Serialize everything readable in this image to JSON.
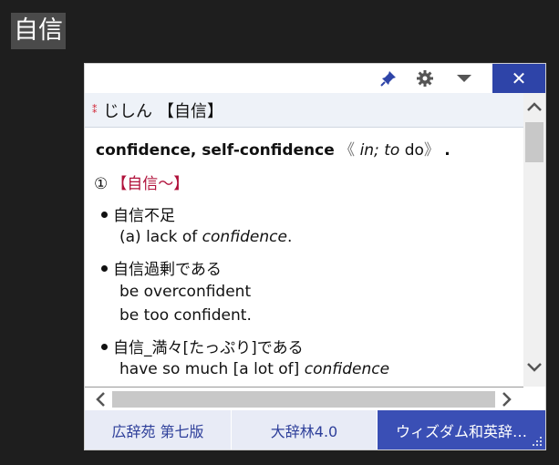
{
  "selection": {
    "text": "自信"
  },
  "toolbar": {
    "pin_icon": "pin-icon",
    "settings_icon": "gear-icon",
    "menu_icon": "dropdown-icon",
    "close_label": "✕"
  },
  "entry": {
    "asterisks": "⁑",
    "reading": "じしん",
    "headword": "【自信】",
    "translation": "confidence, self-confidence",
    "grammar_open": "《",
    "grammar_in": "in;",
    "grammar_to": "to",
    "grammar_do": "do",
    "grammar_close": "》",
    "grammar_end": ".",
    "sense_number": "①",
    "sense_label": "【自信～】",
    "examples": [
      {
        "jp": "自信不足",
        "en": [
          "(a) lack of confidence."
        ]
      },
      {
        "jp": "自信過剰である",
        "en": [
          "be overconfident",
          "be too confident."
        ]
      },
      {
        "jp": "自信_満々[たっぷり]である",
        "en": [
          "have so much [a lot of] confidence"
        ]
      }
    ]
  },
  "tabs": [
    {
      "label": "広辞苑 第七版",
      "active": false
    },
    {
      "label": "大辞林4.0",
      "active": false
    },
    {
      "label": "ウィズダム和英辞…",
      "active": true
    }
  ],
  "colors": {
    "accent": "#2e44a8",
    "active_tab": "#3a4fb5",
    "sense": "#b0103a",
    "background": "#1e1e1e"
  }
}
